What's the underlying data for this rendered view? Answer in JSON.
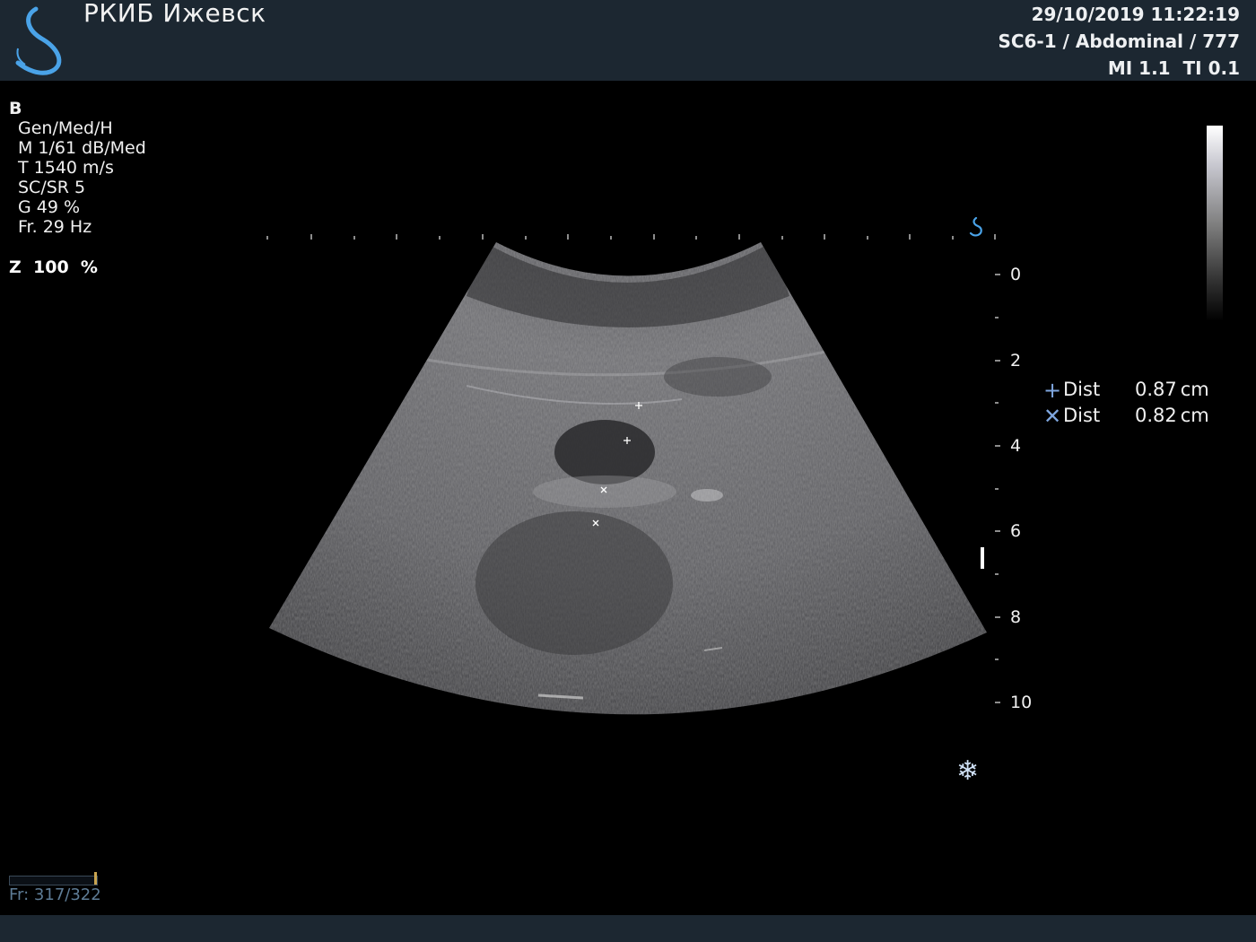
{
  "header": {
    "hospital": "РКИБ Ижевск",
    "datetime": "29/10/2019 11:22:19",
    "probe_preset": "SC6-1 / Abdominal / 777",
    "mi_ti": "MI 1.1  TI 0.1"
  },
  "params": {
    "mode": "B",
    "lines": [
      "Gen/Med/H",
      "M 1/61 dB/Med",
      "T 1540 m/s",
      "SC/SR 5",
      "G 49 %",
      "Fr. 29 Hz"
    ],
    "zoom": "Z  100  %"
  },
  "depth_scale": {
    "labels": [
      "0",
      "2",
      "4",
      "6",
      "8",
      "10"
    ]
  },
  "measurements": [
    {
      "symbol": "+",
      "label": "Dist",
      "value": "0.87",
      "unit": "cm"
    },
    {
      "symbol": "✕",
      "label": "Dist",
      "value": "0.82",
      "unit": "cm"
    }
  ],
  "status": {
    "frame": "Fr: 317/322",
    "freeze_icon": "snowflake-icon"
  },
  "colors": {
    "header_bg": "#1c2731",
    "logo": "#4aa3e8",
    "caliper": "#7fa7e0"
  }
}
